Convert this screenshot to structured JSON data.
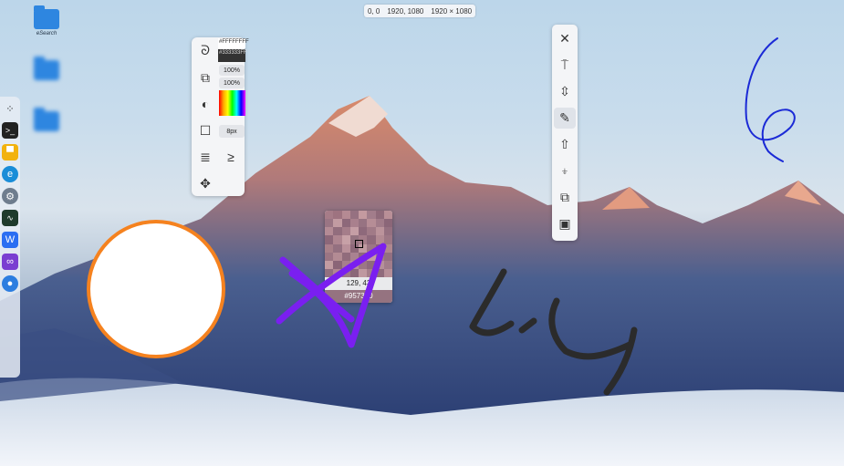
{
  "coord_readout": {
    "origin": "0, 0",
    "point": "1920, 1080",
    "size": "1920 × 1080"
  },
  "desktop": {
    "icons": [
      {
        "label": "eSearch"
      },
      {
        "label": ""
      },
      {
        "label": ""
      }
    ]
  },
  "dock": {
    "apps": [
      "more-icon",
      "terminal-icon",
      "file-manager-icon",
      "edge-icon",
      "settings-icon",
      "monitor-icon",
      "wps-icon",
      "visual-studio-icon",
      "chromium-icon"
    ]
  },
  "draw_panel": {
    "fill_color": "#FFFFFFFF",
    "stroke_color": "#333333FF",
    "fill_opacity": "100%",
    "stroke_opacity": "100%",
    "stroke_width": "8px"
  },
  "magnifier": {
    "coord": "129, 43",
    "hex": "#957380"
  },
  "colors": {
    "accent_circle_border": "#f5821f",
    "purple_ink": "#7a1ff0",
    "blue_ink": "#1b2ad6",
    "dark_ink": "#2b2b2b"
  }
}
